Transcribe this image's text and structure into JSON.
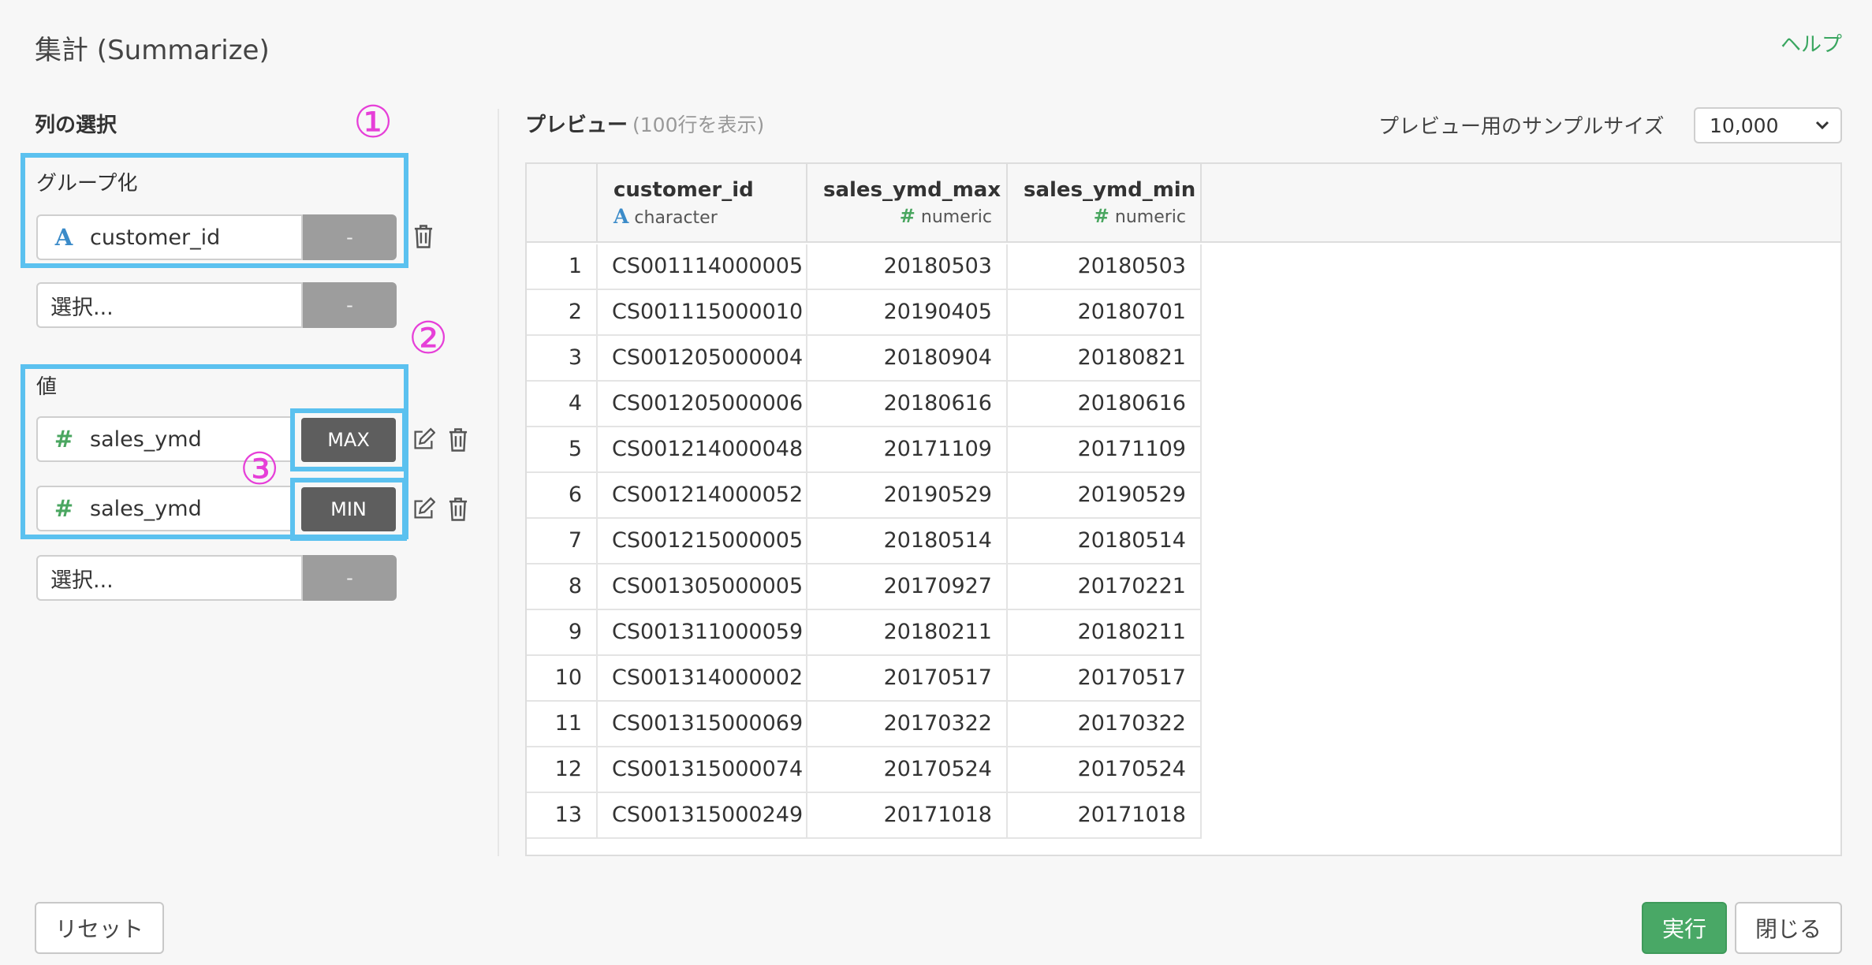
{
  "dialog": {
    "title": "集計 (Summarize)",
    "help": "ヘルプ"
  },
  "column_select": {
    "title": "列の選択",
    "group_label": "グループ化",
    "group_fields": [
      {
        "icon": "A",
        "name": "customer_id",
        "agg": "-"
      }
    ],
    "group_placeholder": "選択...",
    "group_placeholder_btn": "-",
    "value_label": "値",
    "value_fields": [
      {
        "icon": "#",
        "name": "sales_ymd",
        "agg": "MAX"
      },
      {
        "icon": "#",
        "name": "sales_ymd",
        "agg": "MIN"
      }
    ],
    "value_placeholder": "選択...",
    "value_placeholder_btn": "-"
  },
  "annotations": {
    "one": "①",
    "two": "②",
    "three": "③"
  },
  "preview": {
    "title": "プレビュー",
    "subtitle": "(100行を表示)",
    "sample_label": "プレビュー用のサンプルサイズ",
    "sample_value": "10,000",
    "columns": [
      {
        "name": "customer_id",
        "type_icon": "A",
        "type": "character"
      },
      {
        "name": "sales_ymd_max",
        "type_icon": "#",
        "type": "numeric"
      },
      {
        "name": "sales_ymd_min",
        "type_icon": "#",
        "type": "numeric"
      }
    ],
    "rows": [
      [
        "1",
        "CS001114000005",
        "20180503",
        "20180503"
      ],
      [
        "2",
        "CS001115000010",
        "20190405",
        "20180701"
      ],
      [
        "3",
        "CS001205000004",
        "20180904",
        "20180821"
      ],
      [
        "4",
        "CS001205000006",
        "20180616",
        "20180616"
      ],
      [
        "5",
        "CS001214000048",
        "20171109",
        "20171109"
      ],
      [
        "6",
        "CS001214000052",
        "20190529",
        "20190529"
      ],
      [
        "7",
        "CS001215000005",
        "20180514",
        "20180514"
      ],
      [
        "8",
        "CS001305000005",
        "20170927",
        "20170221"
      ],
      [
        "9",
        "CS001311000059",
        "20180211",
        "20180211"
      ],
      [
        "10",
        "CS001314000002",
        "20170517",
        "20170517"
      ],
      [
        "11",
        "CS001315000069",
        "20170322",
        "20170322"
      ],
      [
        "12",
        "CS001315000074",
        "20170524",
        "20170524"
      ],
      [
        "13",
        "CS001315000249",
        "20171018",
        "20171018"
      ]
    ]
  },
  "footer": {
    "reset": "リセット",
    "run": "実行",
    "close": "閉じる"
  },
  "colors": {
    "accent": "#49a866",
    "highlight": "#5bc1ef",
    "annotation": "#e63fd8"
  }
}
